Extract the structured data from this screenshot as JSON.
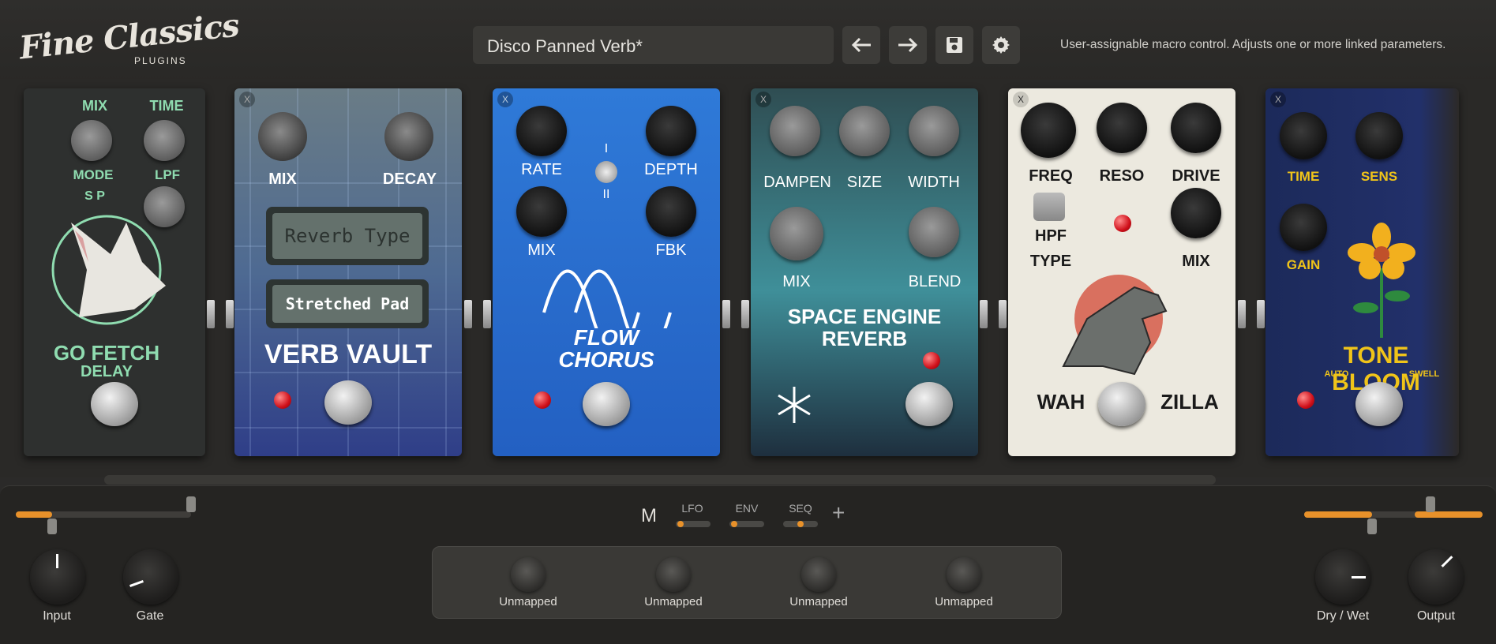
{
  "app": {
    "logo_main": "Fine Classics",
    "logo_sub": "PLUGINS"
  },
  "header": {
    "preset_name": "Disco Panned Verb*",
    "help_text": "User-assignable macro control. Adjusts one or more linked parameters."
  },
  "pedals": {
    "fetch": {
      "mix": "MIX",
      "time": "TIME",
      "mode": "MODE",
      "lpf": "LPF",
      "mode_switch": "S  P",
      "name": "GO FETCH",
      "sub": "DELAY"
    },
    "verb": {
      "x": "X",
      "mix": "MIX",
      "decay": "DECAY",
      "display1": "Reverb Type",
      "display2": "Stretched Pad",
      "name": "VERB VAULT"
    },
    "chorus": {
      "x": "X",
      "rate": "RATE",
      "depth": "DEPTH",
      "mix": "MIX",
      "fbk": "FBK",
      "sw_top": "I",
      "sw_bot": "II",
      "name1": "FLOW",
      "name2": "CHORUS"
    },
    "space": {
      "x": "X",
      "dampen": "DAMPEN",
      "size": "SIZE",
      "width": "WIDTH",
      "mix": "MIX",
      "blend": "BLEND",
      "name1": "SPACE ENGINE",
      "name2": "REVERB"
    },
    "wah": {
      "x": "X",
      "freq": "FREQ",
      "reso": "RESO",
      "drive": "DRIVE",
      "hpf": "HPF",
      "type": "TYPE",
      "mix": "MIX",
      "name_left": "WAH",
      "name_right": "ZILLA"
    },
    "bloom": {
      "x": "X",
      "time": "TIME",
      "sens": "SENS",
      "gain": "GAIN",
      "name": "TONE BLOOM",
      "auto": "AUTO",
      "swell": "SWELL"
    }
  },
  "controls": {
    "input_label": "Input",
    "gate_label": "Gate",
    "drywet_label": "Dry / Wet",
    "output_label": "Output",
    "mod_m": "M",
    "mod_lfo": "LFO",
    "mod_env": "ENV",
    "mod_seq": "SEQ",
    "mod_add": "+",
    "macros": [
      {
        "label": "Unmapped"
      },
      {
        "label": "Unmapped"
      },
      {
        "label": "Unmapped"
      },
      {
        "label": "Unmapped"
      }
    ]
  },
  "colors": {
    "accent": "#e8912a",
    "bg": "#2b2a29",
    "led": "#d0101a"
  }
}
